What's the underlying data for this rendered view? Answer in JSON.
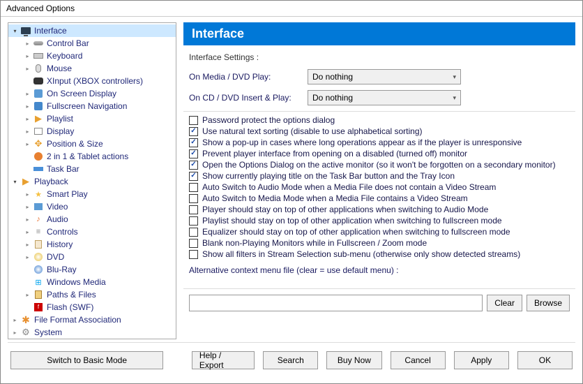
{
  "window_title": "Advanced Options",
  "tree": [
    {
      "label": "Interface",
      "depth": 0,
      "exp": "open",
      "icon": "monitor",
      "sel": true
    },
    {
      "label": "Control Bar",
      "depth": 1,
      "exp": "closed",
      "icon": "slider"
    },
    {
      "label": "Keyboard",
      "depth": 1,
      "exp": "closed",
      "icon": "kb"
    },
    {
      "label": "Mouse",
      "depth": 1,
      "exp": "closed",
      "icon": "mouse"
    },
    {
      "label": "XInput (XBOX controllers)",
      "depth": 1,
      "exp": "none",
      "icon": "xbox"
    },
    {
      "label": "On Screen Display",
      "depth": 1,
      "exp": "closed",
      "icon": "osd"
    },
    {
      "label": "Fullscreen Navigation",
      "depth": 1,
      "exp": "closed",
      "icon": "nav"
    },
    {
      "label": "Playlist",
      "depth": 1,
      "exp": "closed",
      "icon": "play"
    },
    {
      "label": "Display",
      "depth": 1,
      "exp": "closed",
      "icon": "disp"
    },
    {
      "label": "Position & Size",
      "depth": 1,
      "exp": "closed",
      "icon": "pos"
    },
    {
      "label": "2 in 1 & Tablet actions",
      "depth": 1,
      "exp": "none",
      "icon": "tab"
    },
    {
      "label": "Task Bar",
      "depth": 1,
      "exp": "none",
      "icon": "task"
    },
    {
      "label": "Playback",
      "depth": 0,
      "exp": "open",
      "icon": "play"
    },
    {
      "label": "Smart Play",
      "depth": 1,
      "exp": "closed",
      "icon": "smart"
    },
    {
      "label": "Video",
      "depth": 1,
      "exp": "closed",
      "icon": "vid"
    },
    {
      "label": "Audio",
      "depth": 1,
      "exp": "closed",
      "icon": "aud"
    },
    {
      "label": "Controls",
      "depth": 1,
      "exp": "closed",
      "icon": "ctrl"
    },
    {
      "label": "History",
      "depth": 1,
      "exp": "closed",
      "icon": "hist"
    },
    {
      "label": "DVD",
      "depth": 1,
      "exp": "closed",
      "icon": "dvd"
    },
    {
      "label": "Blu-Ray",
      "depth": 1,
      "exp": "none",
      "icon": "br"
    },
    {
      "label": "Windows Media",
      "depth": 1,
      "exp": "none",
      "icon": "wm"
    },
    {
      "label": "Paths & Files",
      "depth": 1,
      "exp": "closed",
      "icon": "pf"
    },
    {
      "label": "Flash (SWF)",
      "depth": 1,
      "exp": "none",
      "icon": "swf"
    },
    {
      "label": "File Format Association",
      "depth": 0,
      "exp": "closed",
      "icon": "ffa"
    },
    {
      "label": "System",
      "depth": 0,
      "exp": "closed",
      "icon": "sys"
    }
  ],
  "content": {
    "header": "Interface",
    "group_label": "Interface Settings :",
    "rows": [
      {
        "label": "On Media / DVD Play:",
        "value": "Do nothing"
      },
      {
        "label": "On CD / DVD Insert & Play:",
        "value": "Do nothing"
      }
    ],
    "checks": [
      {
        "checked": false,
        "label": "Password protect the options dialog"
      },
      {
        "checked": true,
        "label": "Use natural text sorting (disable to use alphabetical sorting)"
      },
      {
        "checked": true,
        "label": "Show a pop-up in cases where long operations appear as if the player is unresponsive"
      },
      {
        "checked": true,
        "label": "Prevent player interface from opening on a disabled (turned off) monitor"
      },
      {
        "checked": true,
        "label": "Open the Options Dialog on the active monitor (so it won't be forgotten on a secondary monitor)"
      },
      {
        "checked": true,
        "label": "Show currently playing title on the Task Bar button and the Tray Icon"
      },
      {
        "checked": false,
        "label": "Auto Switch to Audio Mode when a Media File does not contain a Video Stream"
      },
      {
        "checked": false,
        "label": "Auto Switch to Media Mode when a Media File contains a Video Stream"
      },
      {
        "checked": false,
        "label": "Player should stay on top of other applications when switching to Audio Mode"
      },
      {
        "checked": false,
        "label": "Playlist should stay on top of other application when switching to fullscreen mode"
      },
      {
        "checked": false,
        "label": "Equalizer should stay on top of other application when switching to fullscreen mode"
      },
      {
        "checked": false,
        "label": "Blank non-Playing Monitors while in Fullscreen / Zoom mode"
      },
      {
        "checked": false,
        "label": "Show all filters in Stream Selection sub-menu (otherwise only show detected streams)"
      }
    ],
    "alt_label": "Alternative context menu file (clear = use default menu) :",
    "alt_value": "",
    "clear_btn": "Clear",
    "browse_btn": "Browse"
  },
  "footer": {
    "basic": "Switch to Basic Mode",
    "help": "Help / Export",
    "search": "Search",
    "buy": "Buy Now",
    "cancel": "Cancel",
    "apply": "Apply",
    "ok": "OK"
  }
}
